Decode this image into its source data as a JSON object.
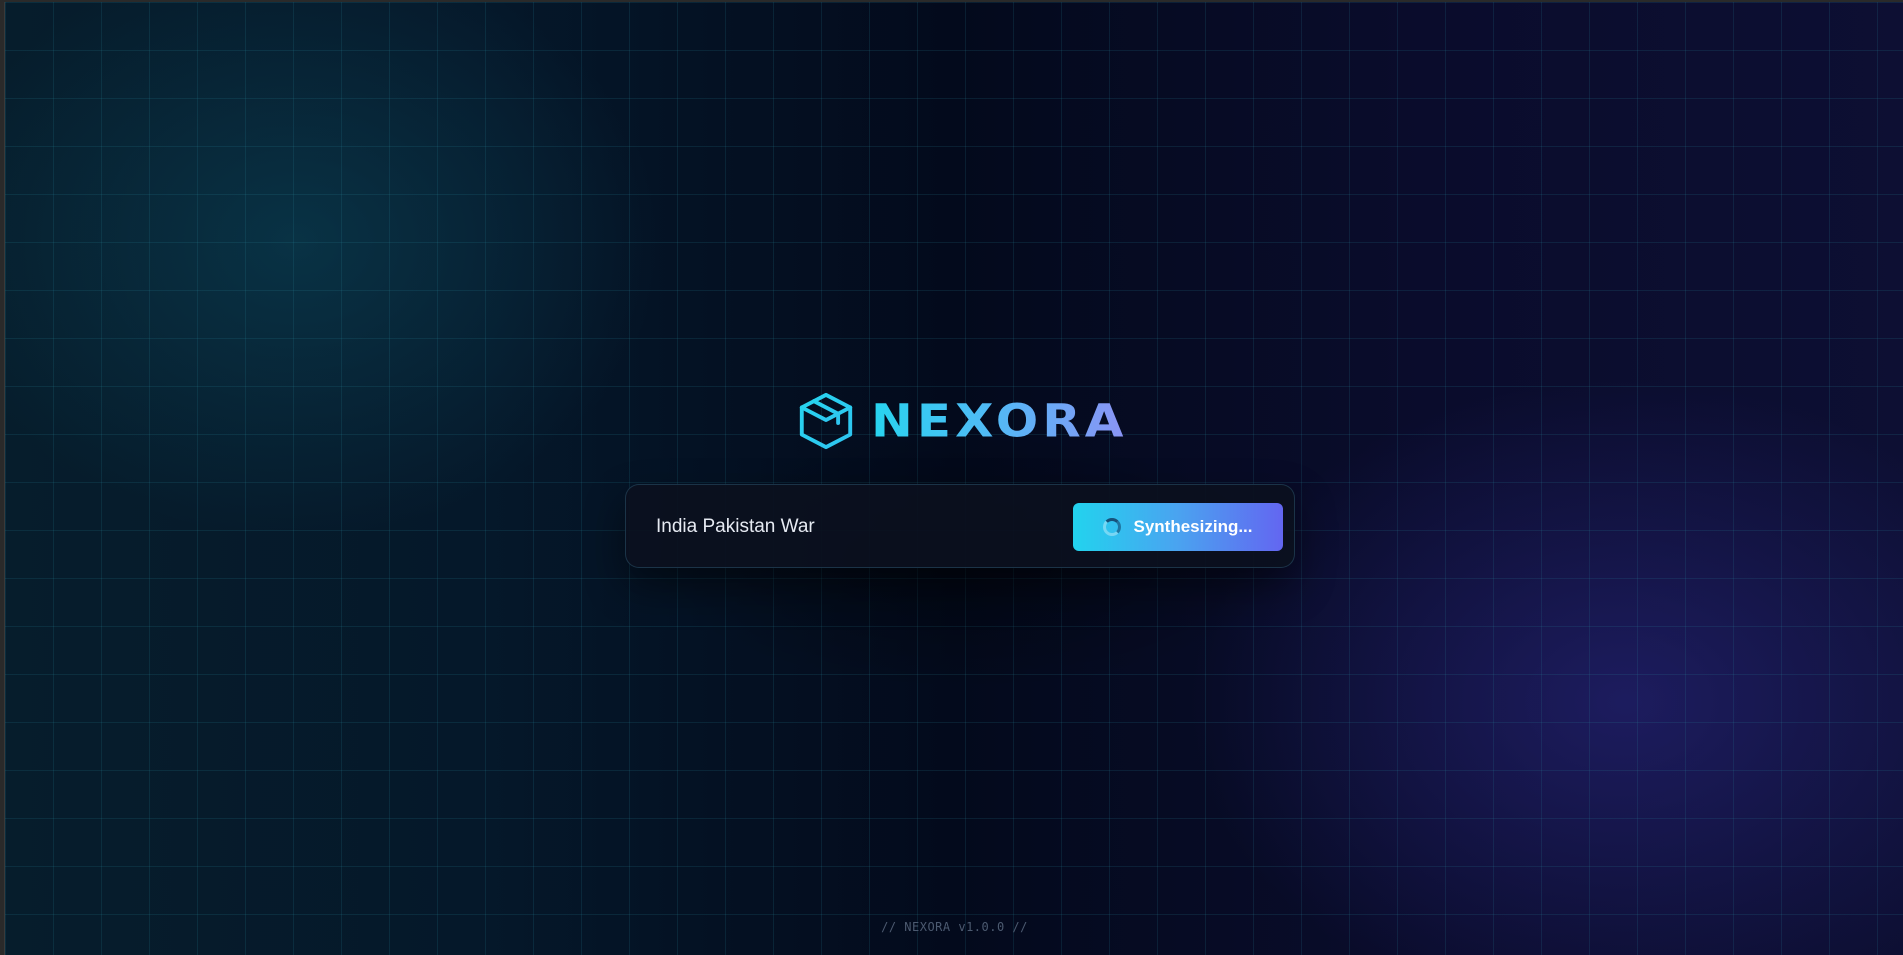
{
  "brand": {
    "name": "NEXORA",
    "icon": "cube-icon",
    "gradient_start": "#27d4ef",
    "gradient_end": "#8c93f5"
  },
  "search": {
    "query_value": "India Pakistan War",
    "button_label": "Synthesizing...",
    "button_state": "loading",
    "button_icon": "spinner-icon"
  },
  "footer": {
    "version_text": "// NEXORA v1.0.0 //"
  },
  "colors": {
    "accent_cyan": "#22d3ee",
    "accent_indigo": "#6366f1",
    "background_dark": "#030a1c"
  }
}
